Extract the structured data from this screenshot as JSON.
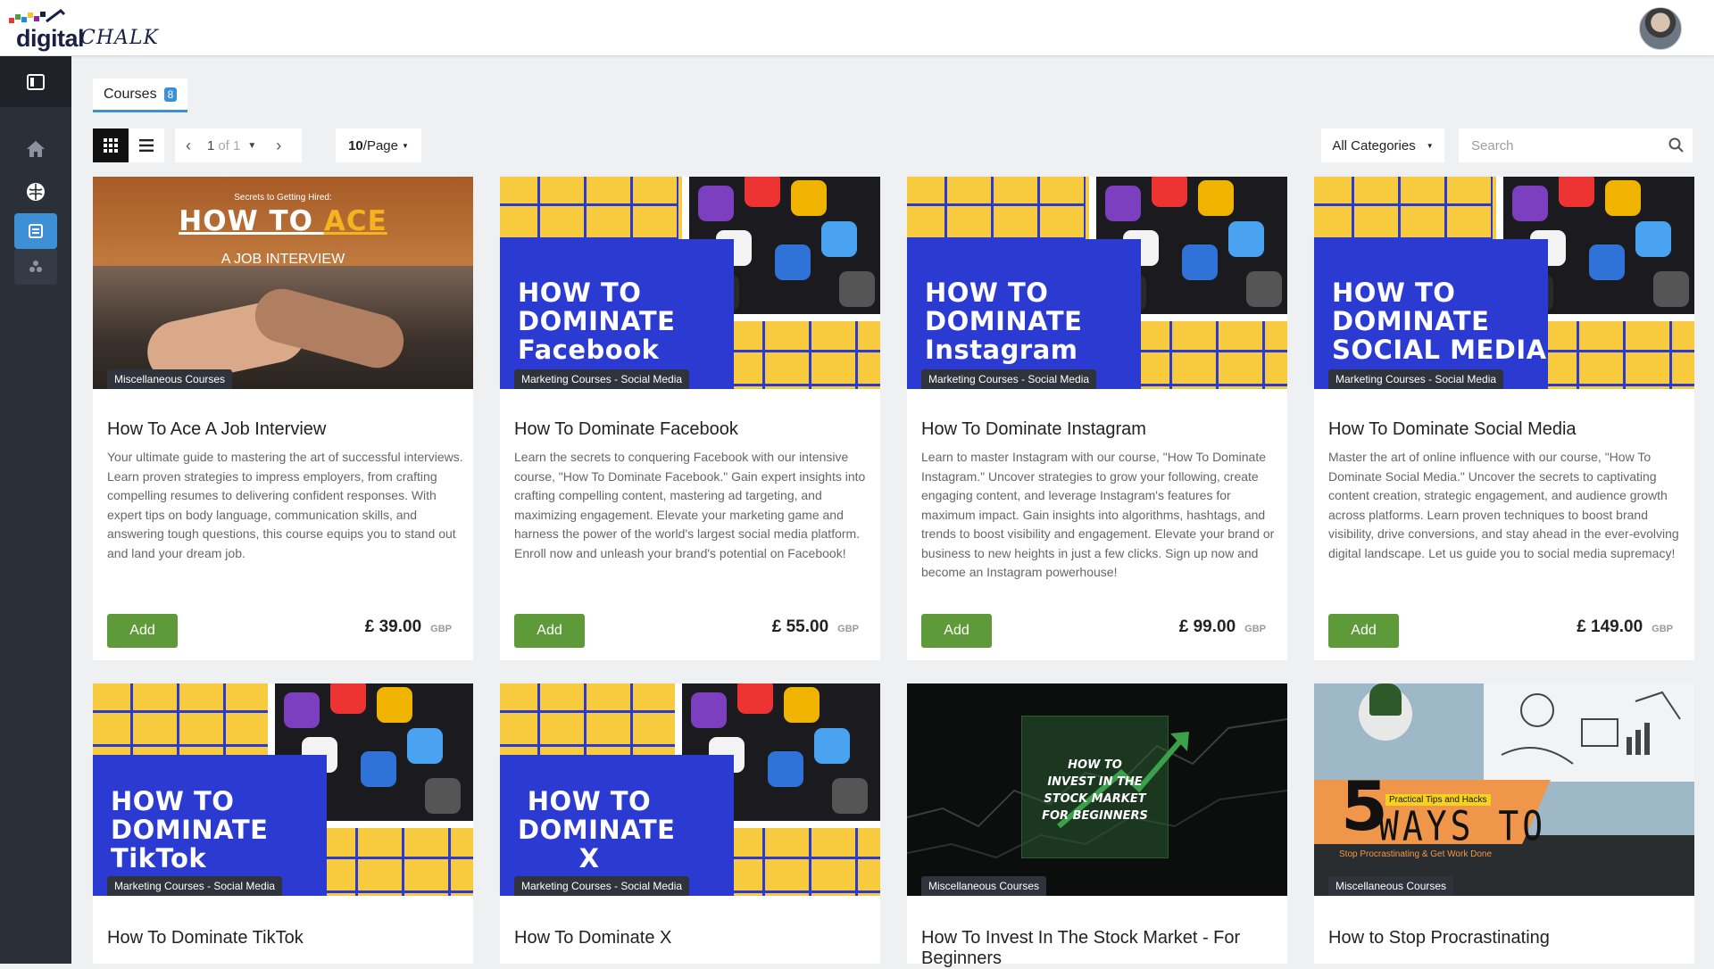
{
  "brand": {
    "word1": "digital",
    "word2": "CHALK"
  },
  "sidebar": {
    "items": [
      {
        "name": "sidebar-toggle",
        "icon": "panel-icon"
      },
      {
        "name": "home",
        "icon": "home-icon"
      },
      {
        "name": "brain",
        "icon": "brain-icon"
      },
      {
        "name": "catalog",
        "icon": "catalog-icon",
        "active": true
      },
      {
        "name": "users",
        "icon": "users-icon"
      }
    ]
  },
  "tabs": {
    "courses_label": "Courses",
    "courses_count": "8"
  },
  "toolbar": {
    "page_current": "1",
    "page_of": "of 1",
    "per_page_value": "10",
    "per_page_suffix": "/Page",
    "category": "All Categories",
    "search_placeholder": "Search"
  },
  "colors": {
    "accent": "#3d8fd6",
    "add_button": "#5e9a3a",
    "sidebar": "#2b3038"
  },
  "courses": [
    {
      "category": "Miscellaneous Courses",
      "title": "How To Ace A Job Interview",
      "description": "Your ultimate guide to mastering the art of successful interviews. Learn proven strategies to impress employers, from crafting compelling resumes to delivering confident responses. With expert tips on body language, communication skills, and answering tough questions, this course equips you to stand out and land your dream job.",
      "add_label": "Add",
      "price": "£ 39.00",
      "currency": "GBP",
      "thumb": {
        "kicker": "Secrets to Getting Hired:",
        "line1a": "HOW TO ",
        "line1b": "ACE",
        "line2": "A JOB INTERVIEW"
      }
    },
    {
      "category": "Marketing Courses - Social Media",
      "title": "How To Dominate Facebook",
      "description": "Learn the secrets to conquering Facebook with our intensive course, \"How To Dominate Facebook.\" Gain expert insights into crafting compelling content, mastering ad targeting, and maximizing engagement. Elevate your marketing game and harness the power of the world's largest social media platform. Enroll now and unleash your brand's potential on Facebook!",
      "add_label": "Add",
      "price": "£ 55.00",
      "currency": "GBP",
      "thumb": {
        "l1": "HOW TO",
        "l2": "DOMINATE",
        "l3": "Facebook"
      }
    },
    {
      "category": "Marketing Courses - Social Media",
      "title": "How To Dominate Instagram",
      "description": "Learn to master Instagram with our course, \"How To Dominate Instagram.\" Uncover strategies to grow your following, create engaging content, and leverage Instagram's features for maximum impact. Gain insights into algorithms, hashtags, and trends to boost visibility and engagement. Elevate your brand or business to new heights in just a few clicks. Sign up now and become an Instagram powerhouse!",
      "add_label": "Add",
      "price": "£ 99.00",
      "currency": "GBP",
      "thumb": {
        "l1": "HOW TO",
        "l2": "DOMINATE",
        "l3": "Instagram"
      }
    },
    {
      "category": "Marketing Courses - Social Media",
      "title": "How To Dominate Social Media",
      "description": "Master the art of online influence with our course, \"How To Dominate Social Media.\" Uncover the secrets to captivating content creation, strategic engagement, and audience growth across platforms. Learn proven techniques to boost brand visibility, drive conversions, and stay ahead in the ever-evolving digital landscape. Let us guide you to social media supremacy!",
      "add_label": "Add",
      "price": "£ 149.00",
      "currency": "GBP",
      "thumb": {
        "l1": "HOW TO",
        "l2": "DOMINATE",
        "l3": "SOCIAL MEDIA"
      }
    },
    {
      "category": "Marketing Courses - Social Media",
      "title": "How To Dominate TikTok",
      "description": "",
      "thumb": {
        "l1": "HOW TO",
        "l2": "DOMINATE",
        "l3": "TikTok"
      }
    },
    {
      "category": "Marketing Courses - Social Media",
      "title": "How To Dominate X",
      "description": "",
      "thumb": {
        "l1": "HOW TO",
        "l2": "DOMINATE",
        "l3": "X"
      }
    },
    {
      "category": "Miscellaneous Courses",
      "title": "How To Invest In The Stock Market - For Beginners",
      "description": "",
      "thumb": {
        "l1": "HOW TO",
        "l2": "INVEST IN THE",
        "l3": "STOCK MARKET",
        "l4": "FOR BEGINNERS"
      }
    },
    {
      "category": "Miscellaneous Courses",
      "title": "How to Stop Procrastinating",
      "description": "",
      "thumb": {
        "number": "5",
        "kicker": "Practical Tips and Hacks",
        "big": "WAYS TO",
        "sub": "Stop Procrastinating & Get Work Done"
      }
    }
  ]
}
